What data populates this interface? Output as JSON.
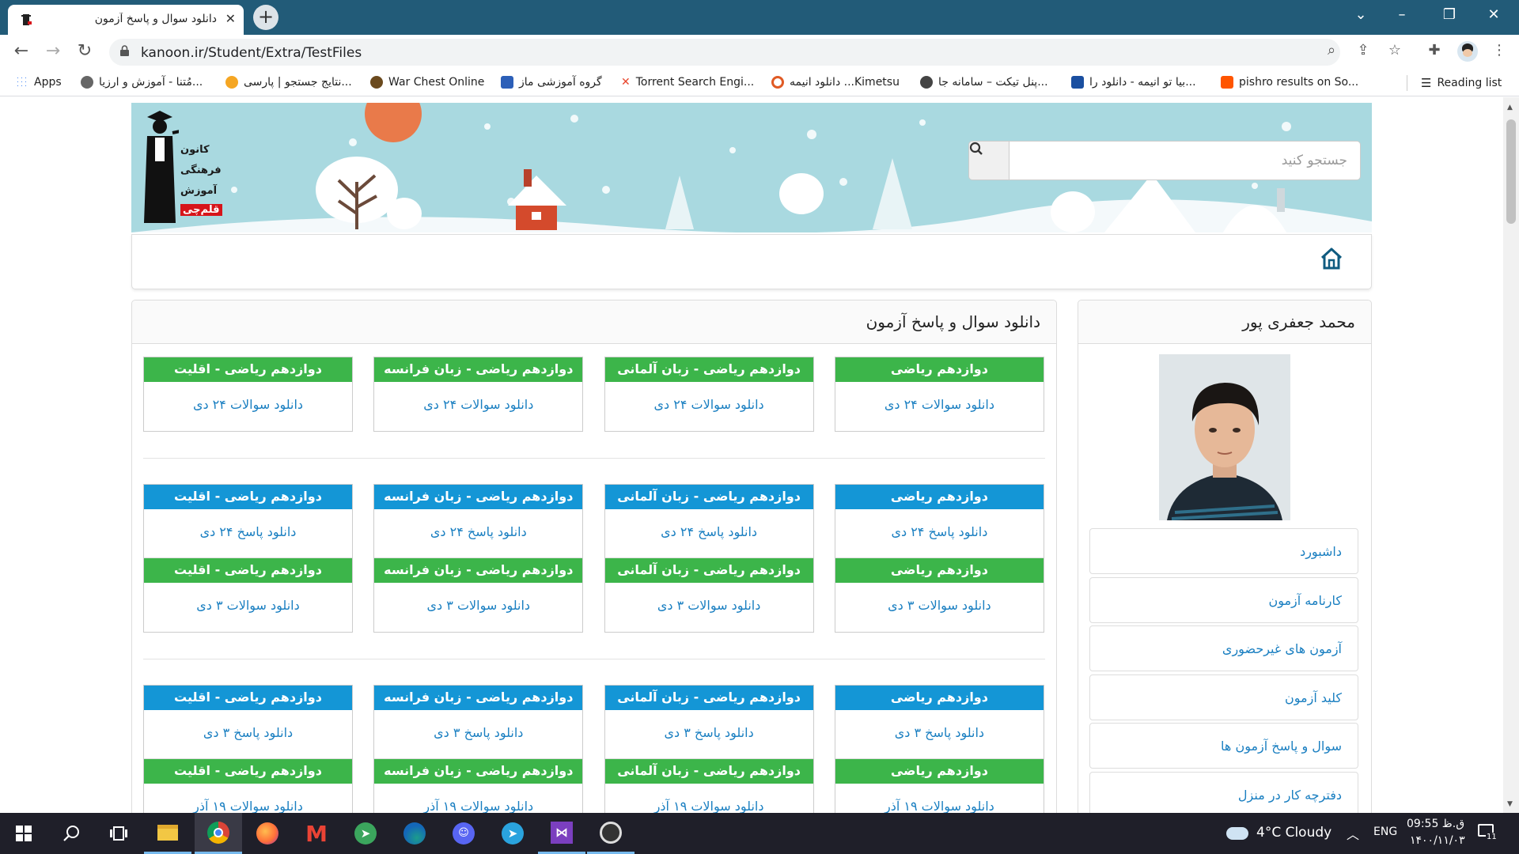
{
  "browser": {
    "tab_title": "دانلود سوال و پاسخ آزمون",
    "url": "kanoon.ir/Student/Extra/TestFiles"
  },
  "bookmarks": [
    {
      "label": "Apps",
      "icon": "apps-grid-icon",
      "color": "#4285f4"
    },
    {
      "label": "مُتنا - آموزش و ارزیا...",
      "icon": "motena-icon",
      "color": "#555555"
    },
    {
      "label": "نتایج جستجو | پارسی...",
      "icon": "sun-icon",
      "color": "#f5a623"
    },
    {
      "label": "War Chest Online",
      "icon": "warchest-icon",
      "color": "#6b4a1e"
    },
    {
      "label": "گروه آموزشی ماز",
      "icon": "maz-icon",
      "color": "#2c5fb8"
    },
    {
      "label": "Torrent Search Engi...",
      "icon": "torrent-x-icon",
      "color": "#e8452c"
    },
    {
      "label": "دانلود انیمه ...Kimetsu",
      "icon": "spiral-icon",
      "color": "#e05a24"
    },
    {
      "label": "پنل تیکت – سامانه جا...",
      "icon": "globe-icon",
      "color": "#444444"
    },
    {
      "label": "بیا تو انیمه - دانلود را...",
      "icon": "anime-icon",
      "color": "#1a4fa0"
    },
    {
      "label": "pishro results on So...",
      "icon": "soundcloud-icon",
      "color": "#ff5500"
    }
  ],
  "reading_list": "Reading list",
  "logo": {
    "line1": "کانون",
    "line2": "فرهنگی",
    "line3": "آموزش",
    "line4": "قلم‌چی"
  },
  "search": {
    "placeholder": "جستجو کنید"
  },
  "main": {
    "title": "دانلود سوال و پاسخ آزمون",
    "columns": [
      "دوازدهم ریاضی",
      "دوازدهم ریاضی - زبان آلمانی",
      "دوازدهم ریاضی - زبان فرانسه",
      "دوازدهم ریاضی - اقلیت"
    ],
    "groups": [
      {
        "rows": [
          {
            "color": "green",
            "link": "دانلود سوالات ۲۴ دی"
          }
        ]
      },
      {
        "rows": [
          {
            "color": "blue",
            "link": "دانلود پاسخ ۲۴ دی"
          },
          {
            "color": "green",
            "link": "دانلود سوالات ۳ دی"
          }
        ]
      },
      {
        "rows": [
          {
            "color": "blue",
            "link": "دانلود پاسخ ۳ دی"
          },
          {
            "color": "green",
            "link": "دانلود سوالات ۱۹ آذر"
          }
        ]
      }
    ]
  },
  "sidebar": {
    "student_name": "محمد جعفری پور",
    "menu": [
      "داشبورد",
      "کارنامه آزمون",
      "آزمون های غیرحضوری",
      "کلید آزمون",
      "سوال و پاسخ آزمون ها",
      "دفترچه کار در منزل"
    ]
  },
  "colors": {
    "green": "#3cb54a",
    "blue": "#1496d6",
    "link": "#1a7fc1",
    "chrome": "#225b78"
  },
  "taskbar": {
    "weather": "4°C  Cloudy",
    "lang": "ENG",
    "time": "09:55 ق.ظ",
    "date": "۱۴۰۰/۱۱/۰۳",
    "notification_count": "11"
  }
}
